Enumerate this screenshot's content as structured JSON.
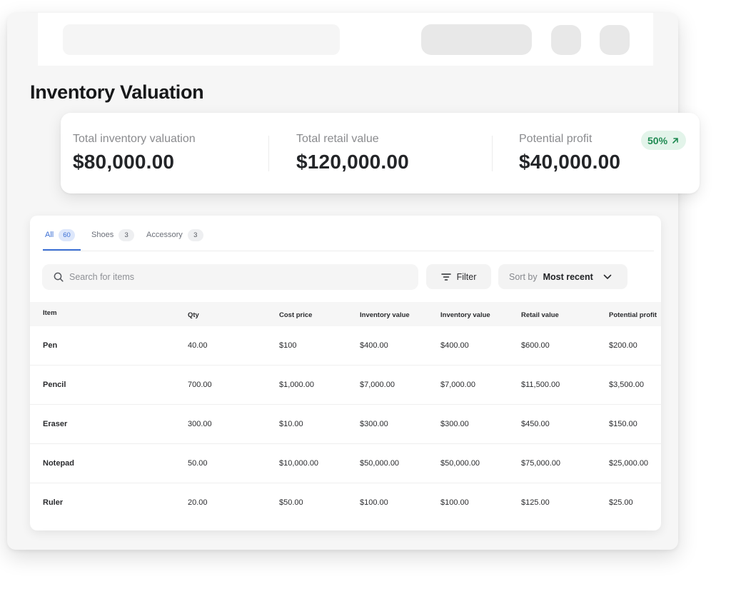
{
  "page": {
    "title": "Inventory Valuation"
  },
  "stats": [
    {
      "label": "Total inventory valuation",
      "value": "$80,000.00"
    },
    {
      "label": "Total retail value",
      "value": "$120,000.00"
    },
    {
      "label": "Potential profit",
      "value": "$40,000.00",
      "badge": "50%",
      "badge_icon": "arrow-up-right-icon",
      "badge_color": "#1f8a52"
    }
  ],
  "tabs": [
    {
      "label": "All",
      "count": "60",
      "active": true
    },
    {
      "label": "Shoes",
      "count": "3",
      "active": false
    },
    {
      "label": "Accessory",
      "count": "3",
      "active": false
    }
  ],
  "toolbar": {
    "search_placeholder": "Search for items",
    "search_value": "",
    "filter_label": "Filter",
    "sort_label": "Sort by",
    "sort_value": "Most recent"
  },
  "table": {
    "columns": [
      "Item",
      "Qty",
      "Cost price",
      "Inventory value",
      "Inventory value",
      "Retail value",
      "Potential profit"
    ],
    "rows": [
      [
        "Pen",
        "40.00",
        "$100",
        "$400.00",
        "$400.00",
        "$600.00",
        "$200.00"
      ],
      [
        "Pencil",
        "700.00",
        "$1,000.00",
        "$7,000.00",
        "$7,000.00",
        "$11,500.00",
        "$3,500.00"
      ],
      [
        "Eraser",
        "300.00",
        "$10.00",
        "$300.00",
        "$300.00",
        "$450.00",
        "$150.00"
      ],
      [
        "Notepad",
        "50.00",
        "$10,000.00",
        "$50,000.00",
        "$50,000.00",
        "$75,000.00",
        "$25,000.00"
      ],
      [
        "Ruler",
        "20.00",
        "$50.00",
        "$100.00",
        "$100.00",
        "$125.00",
        "$25.00"
      ]
    ]
  },
  "colors": {
    "accent": "#3b6fd4",
    "positive": "#1f8a52",
    "positive_bg": "#e3f4ea"
  }
}
